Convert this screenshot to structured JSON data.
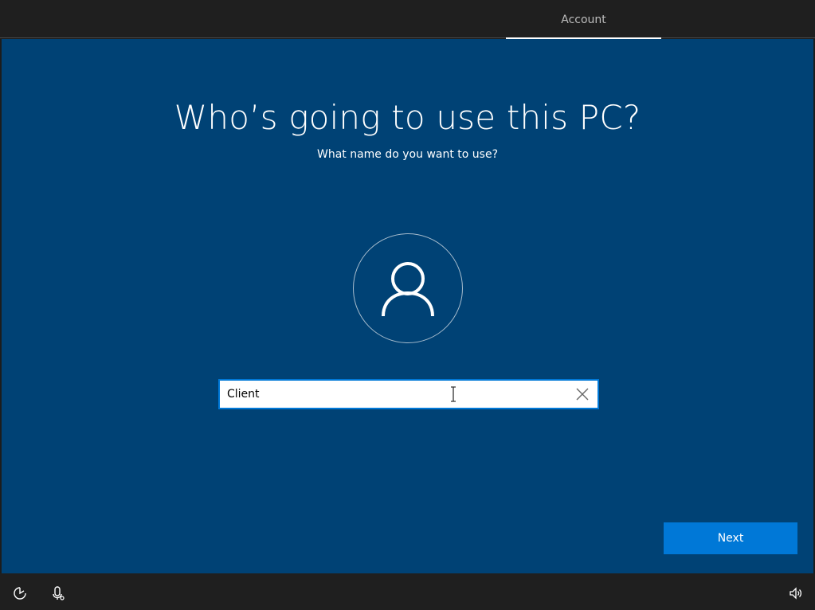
{
  "header": {
    "steps": [
      {
        "label": "Account",
        "active": true
      }
    ]
  },
  "main": {
    "title": "Who’s going to use this PC?",
    "subtitle": "What name do you want to use?",
    "avatar_icon": "user-icon",
    "name_input": {
      "value": "Client",
      "clear_icon": "close-icon"
    },
    "next_label": "Next"
  },
  "bottom_bar": {
    "left_icons": [
      "ease-of-access-icon",
      "microphone-icon"
    ],
    "right_icons": [
      "volume-icon"
    ]
  },
  "colors": {
    "panel_background": "#004275",
    "accent": "#0078d7",
    "bar_background": "#1f1f1f",
    "text": "#ffffff"
  }
}
